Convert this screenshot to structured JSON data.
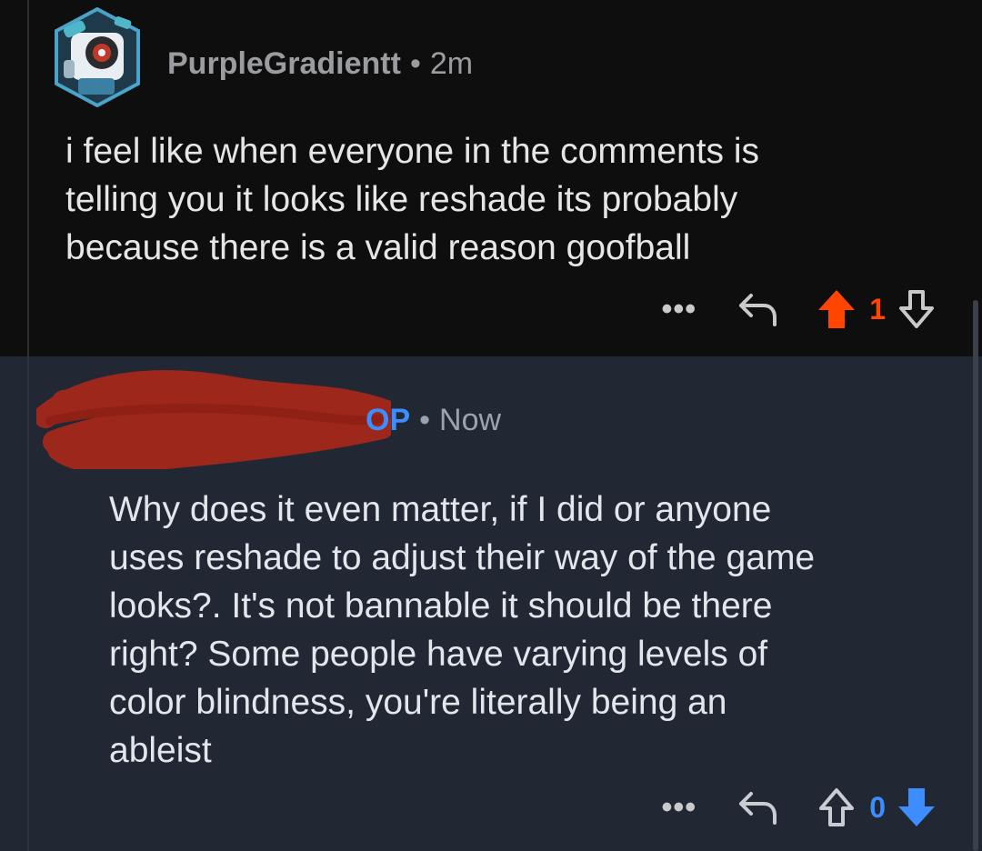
{
  "comment_1": {
    "username": "PurpleGradientt",
    "separator": "•",
    "time": "2m",
    "body": "i feel like when everyone in the comments is\ntelling you it looks like reshade its probably\nbecause there is a valid reason goofball",
    "more_label": "•••",
    "score": "1",
    "upvoted": true,
    "colors": {
      "upvote": "#ff4500",
      "text": "#e6e6e8"
    }
  },
  "comment_2": {
    "username_visible": "OP",
    "separator": "•",
    "time": "Now",
    "body": "Why does it even matter, if I did or anyone\nuses reshade to adjust their way of the game\nlooks?.  It's not bannable it should be there\nright?  Some people have varying levels of\ncolor blindness, you're literally being an\nableist",
    "more_label": "•••",
    "score": "0",
    "downvoted": true,
    "colors": {
      "downvote": "#3d8dff",
      "op_label": "#3d8dff",
      "background": "#212833"
    }
  },
  "icons": {
    "avatar": "snoo-avatar-icon",
    "reply": "reply-arrow-icon",
    "upvote": "upvote-arrow-icon",
    "downvote": "downvote-arrow-icon",
    "redaction": "red-scribble-redaction"
  }
}
